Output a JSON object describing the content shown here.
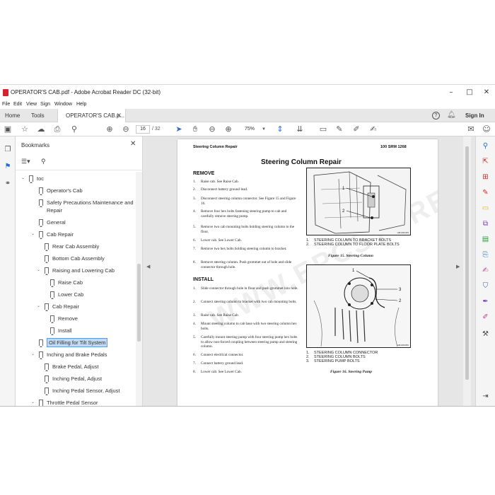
{
  "window": {
    "title": "OPERATOR'S CAB.pdf - Adobe Acrobat Reader DC (32-bit)",
    "minimize": "–",
    "maximize": "□",
    "close": "✕"
  },
  "menu": [
    "File",
    "Edit",
    "View",
    "Sign",
    "Window",
    "Help"
  ],
  "tabs": {
    "home": "Home",
    "tools": "Tools",
    "doc": "OPERATOR'S CAB.p...",
    "sign_in": "Sign In"
  },
  "toolbar": {
    "page_current": "16",
    "page_total": "/ 32",
    "zoom": "75%"
  },
  "bookmarks": {
    "title": "Bookmarks",
    "items": [
      {
        "label": "toc",
        "level": 0,
        "toggle": "v"
      },
      {
        "label": "Operator's Cab",
        "level": 1,
        "toggle": ""
      },
      {
        "label": "Safety Precautions Maintenance and",
        "label2": "Repair",
        "level": 1,
        "toggle": ""
      },
      {
        "label": "General",
        "level": 1,
        "toggle": ""
      },
      {
        "label": "Cab Repair",
        "level": 1,
        "toggle": "v"
      },
      {
        "label": "Rear Cab Assembly",
        "level": 2,
        "toggle": ""
      },
      {
        "label": "Bottom Cab Assembly",
        "level": 2,
        "toggle": ""
      },
      {
        "label": "Raising and Lowering Cab",
        "level": 2,
        "toggle": "v"
      },
      {
        "label": "Raise Cab",
        "level": 3,
        "toggle": ""
      },
      {
        "label": "Lower Cab",
        "level": 3,
        "toggle": ""
      },
      {
        "label": "Cab Repair",
        "level": 2,
        "toggle": "v"
      },
      {
        "label": "Remove",
        "level": 3,
        "toggle": ""
      },
      {
        "label": "Install",
        "level": 3,
        "toggle": ""
      },
      {
        "label": "Oil Filling for Tilt System",
        "level": 1,
        "toggle": "",
        "selected": true
      },
      {
        "label": "Inching and Brake Pedals",
        "level": 1,
        "toggle": "v"
      },
      {
        "label": "Brake Pedal, Adjust",
        "level": 2,
        "toggle": ""
      },
      {
        "label": "Inching Pedal, Adjust",
        "level": 2,
        "toggle": ""
      },
      {
        "label": "Inching Pedal Sensor, Adjust",
        "level": 2,
        "toggle": ""
      },
      {
        "label": "Throttle Pedal Sensor",
        "level": 1,
        "toggle": "v"
      }
    ]
  },
  "page": {
    "header_left": "Steering Column Repair",
    "header_right": "100 SRM 1268",
    "title": "Steering Column Repair",
    "remove_heading": "REMOVE",
    "install_heading": "INSTALL",
    "remove_steps": [
      {
        "n": "1.",
        "t": "Raise cab. See Raise Cab."
      },
      {
        "n": "2.",
        "t": "Disconnect battery ground lead."
      },
      {
        "n": "3.",
        "t": "Disconnect steering column connector. See Figure 15 and Figure 16."
      },
      {
        "n": "4.",
        "t": "Remove four hex bolts fastening steering pump to cab and carefully remove steering pump."
      },
      {
        "n": "5.",
        "t": "Remove two cab mounting bolts holding steering column to the floor."
      },
      {
        "n": "6.",
        "t": "Lower cab. See Lower Cab."
      },
      {
        "n": "7.",
        "t": "Remove two hex bolts holding steering column to bracket."
      },
      {
        "n": "8.",
        "t": "Remove steering column. Push grommet out of hole and slide connector through hole."
      }
    ],
    "install_steps": [
      {
        "n": "1.",
        "t": "Slide connector through hole in floor and push grommet into hole."
      },
      {
        "n": "2.",
        "t": "Connect steering column to bracket with two cab mounting bolts."
      },
      {
        "n": "3.",
        "t": "Raise cab. See Raise Cab."
      },
      {
        "n": "4.",
        "t": "Mount steering column to cab base with two steering column hex bolts."
      },
      {
        "n": "5.",
        "t": "Carefully mount steering pump with four steering pump hex bolts to allow non-forced coupling between steering pump and steering column."
      },
      {
        "n": "6.",
        "t": "Connect electrical connector."
      },
      {
        "n": "7.",
        "t": "Connect battery ground lead."
      },
      {
        "n": "8.",
        "t": "Lower cab. See Lower Cab."
      }
    ],
    "fig15": {
      "code": "HM1062345",
      "callouts": [
        "1",
        "2"
      ],
      "legend": [
        {
          "n": "1.",
          "t": "STEERING COLUMN TO BRACKET BOLTS"
        },
        {
          "n": "2.",
          "t": "STEERING COLUMN TO FLOOR PLATE BOLTS"
        }
      ],
      "caption": "Figure 15. Steering Column"
    },
    "fig16": {
      "code": "HM1063066",
      "callouts": [
        "1",
        "2",
        "3"
      ],
      "legend": [
        {
          "n": "1.",
          "t": "STEERING COLUMN CONNECTOR"
        },
        {
          "n": "2.",
          "t": "STEERING COLUMN BOLTS"
        },
        {
          "n": "3.",
          "t": "STEERING PUMP BOLTS"
        }
      ],
      "caption": "Figure 16. Steering Pump"
    },
    "watermark": "WWW.EPCSTORE.COM"
  }
}
